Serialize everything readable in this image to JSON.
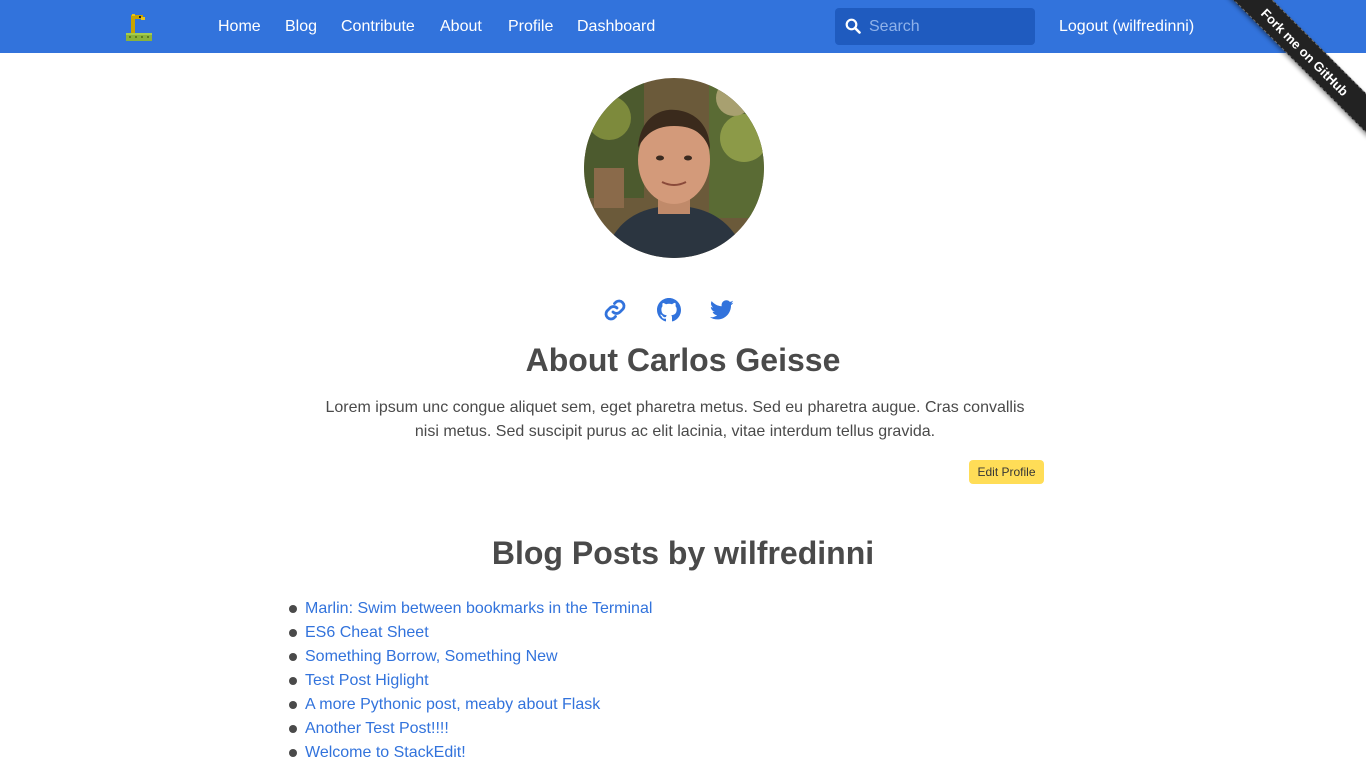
{
  "nav": {
    "logo_icon": "pixel-snake-logo",
    "links": [
      "Home",
      "Blog",
      "Contribute",
      "About",
      "Profile",
      "Dashboard"
    ],
    "search_placeholder": "Search",
    "logout_label": "Logout (wilfredinni)"
  },
  "ribbon": {
    "label": "Fork me on GitHub"
  },
  "profile": {
    "social_icons": [
      "link-icon",
      "github-icon",
      "twitter-icon"
    ],
    "title": "About Carlos Geisse",
    "bio": "Lorem ipsum unc congue aliquet sem, eget pharetra metus. Sed eu pharetra augue. Cras convallis nisi metus. Sed suscipit purus ac elit lacinia, vitae interdum tellus gravida.",
    "edit_label": "Edit Profile"
  },
  "posts": {
    "title": "Blog Posts by wilfredinni",
    "items": [
      "Marlin: Swim between bookmarks in the Terminal",
      "ES6 Cheat Sheet",
      "Something Borrow, Something New",
      "Test Post Higlight",
      "A more Pythonic post, meaby about Flask",
      "Another Test Post!!!!",
      "Welcome to StackEdit!"
    ]
  },
  "colors": {
    "navbar": "#3273dc",
    "link": "#3273dc",
    "edit_button": "#ffdd57",
    "ribbon": "#222222"
  }
}
